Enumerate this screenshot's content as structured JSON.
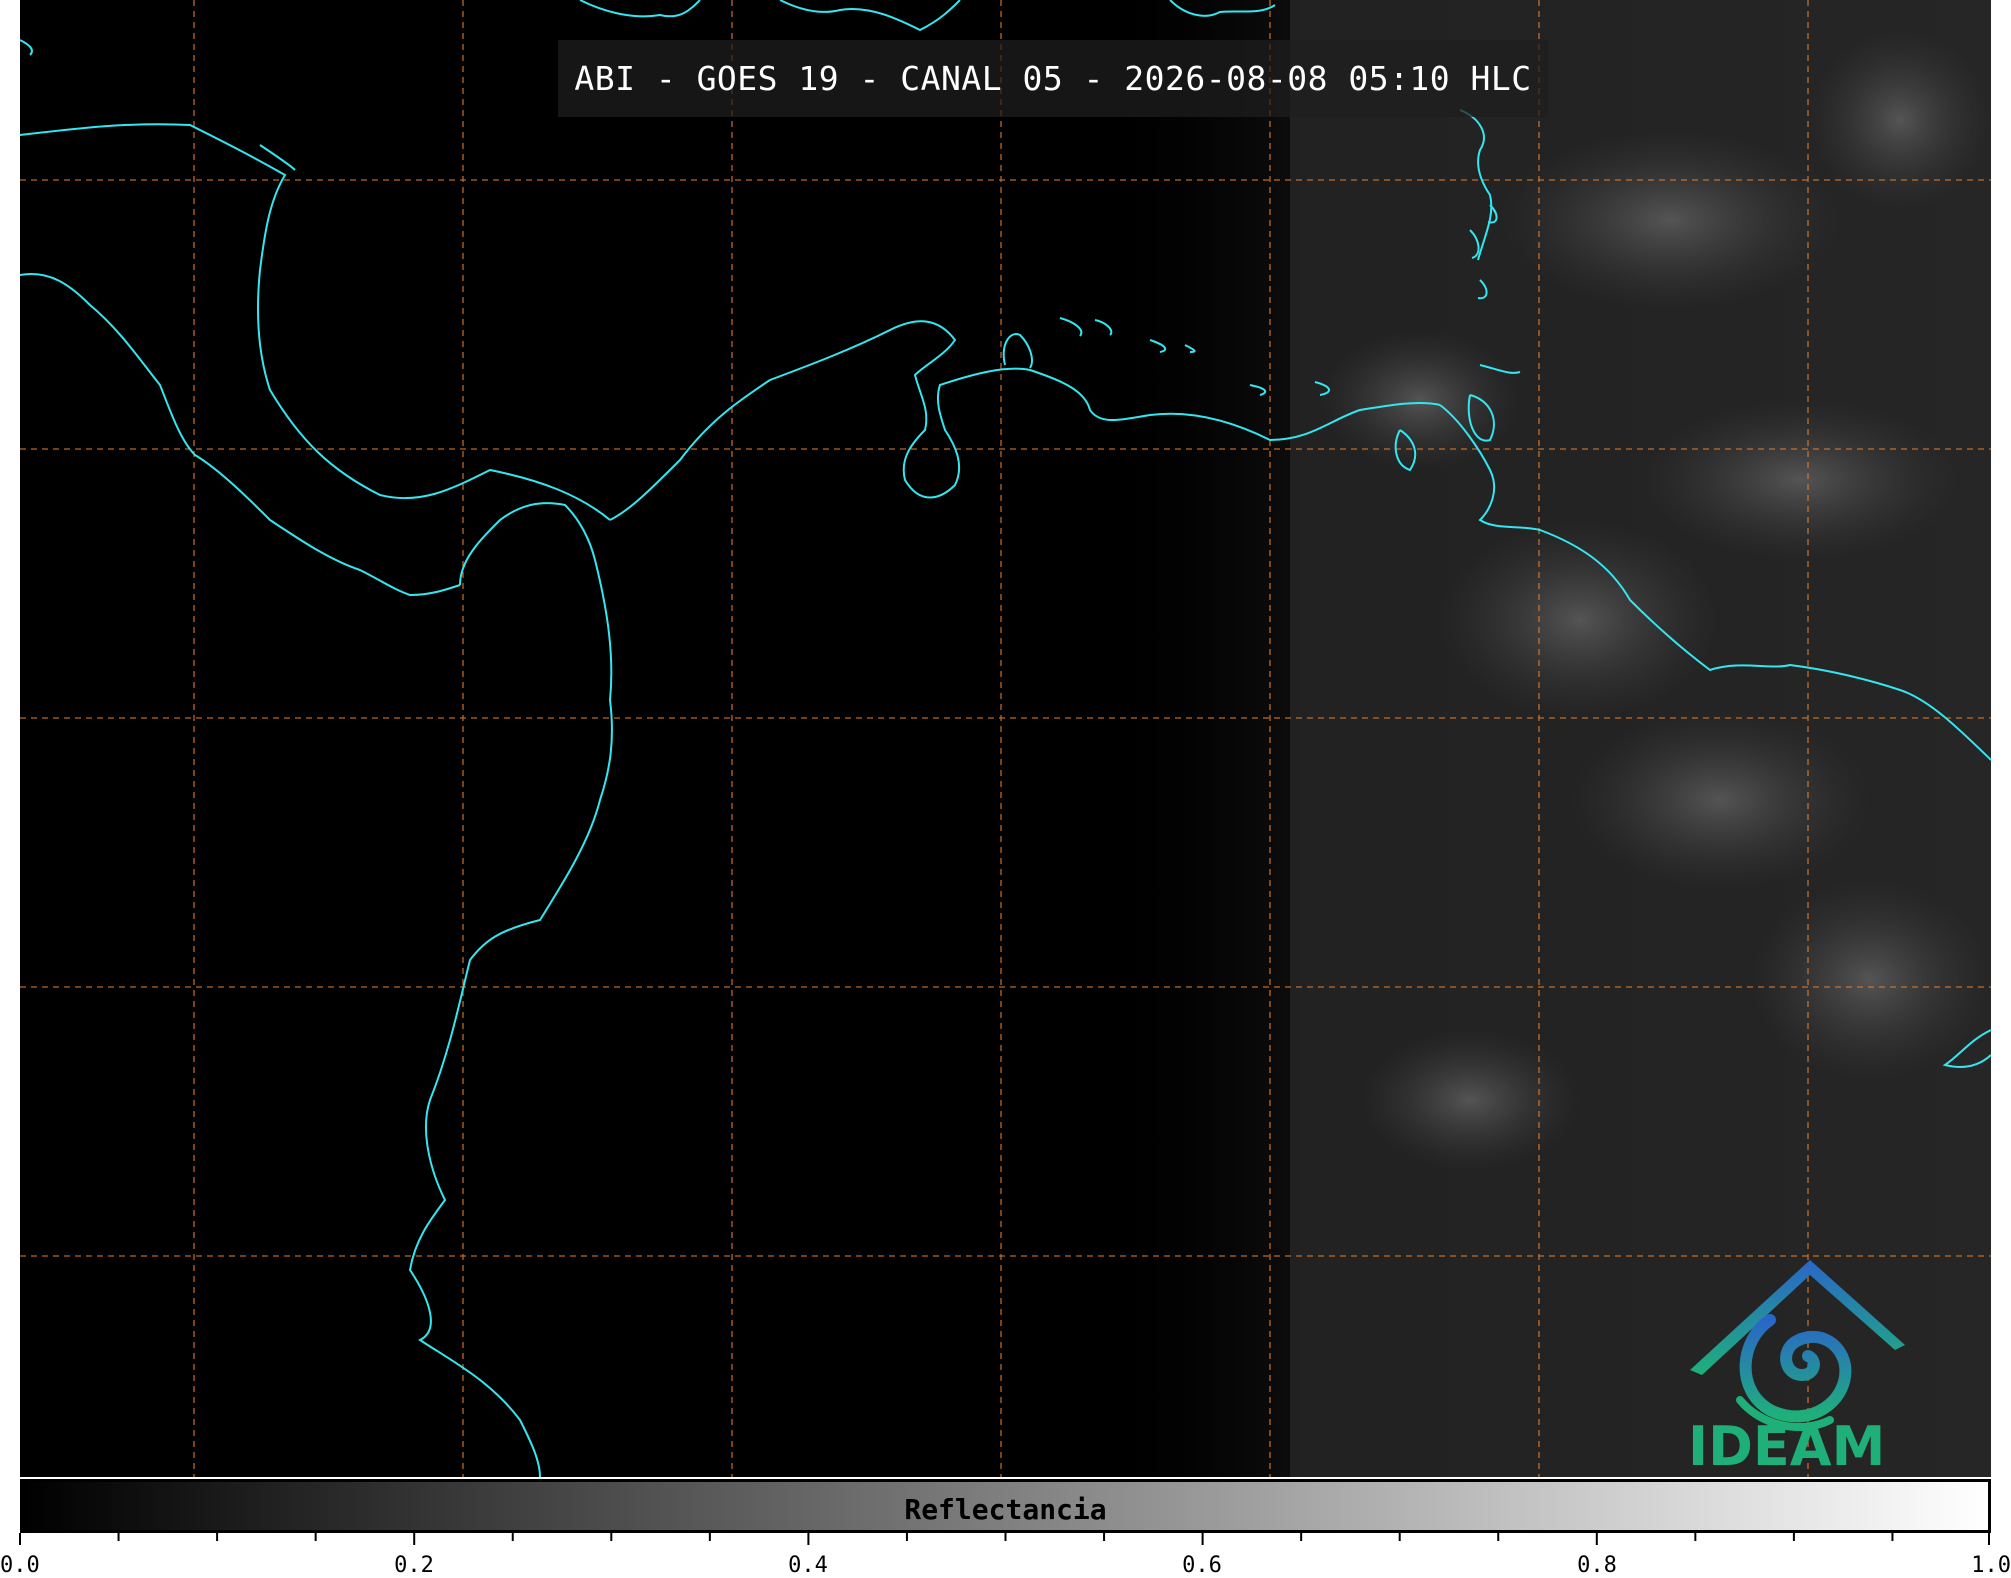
{
  "map": {
    "title": "ABI - GOES 19 - CANAL 05 - 2026-08-08 05:10 HLC",
    "coastline_color": "#33e6f0",
    "grid_color": "#e07a2a",
    "background_color": "#000000",
    "logo": {
      "text": "IDEAM",
      "icon": "ideam-mountain-swirl-icon",
      "color": "#1fb07a"
    }
  },
  "colorbar": {
    "label": "Reflectancia",
    "colormap": "grayscale",
    "range": [
      0.0,
      1.0
    ],
    "tick_labels": [
      "0.0",
      "0.2",
      "0.4",
      "0.6",
      "0.8",
      "1.0"
    ]
  }
}
